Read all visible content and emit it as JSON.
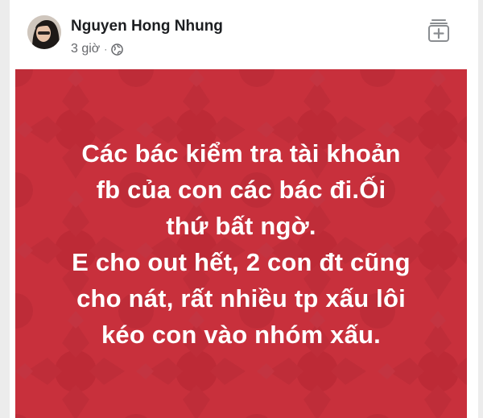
{
  "post": {
    "author": "Nguyen Hong Nhung",
    "time": "3 giờ",
    "separator": "·",
    "privacy_icon": "globe-icon",
    "save_icon": "bookmark-add-icon",
    "avatar_icon": "profile-photo"
  },
  "image": {
    "background_color": "#c8303c",
    "pattern_color": "#bd2b37",
    "text_color": "#ffffff",
    "lines": [
      "Các bác kiểm tra tài khoản",
      "fb của con các bác đi.Ối",
      "thứ bất ngờ.",
      "E cho out hết, 2 con đt cũng",
      "cho nát, rất nhiều tp xấu lôi",
      "kéo con vào nhóm xấu."
    ]
  }
}
